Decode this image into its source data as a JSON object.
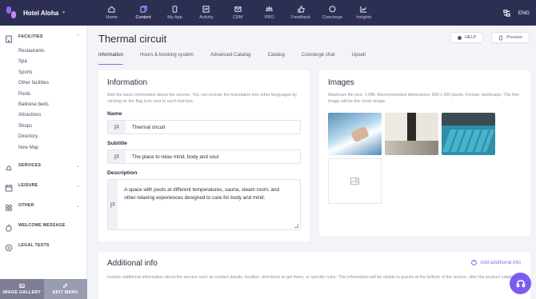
{
  "app": {
    "brand_name": "Hotel Aloha",
    "language": "ENG"
  },
  "nav": [
    {
      "label": "Home",
      "icon": "home-icon"
    },
    {
      "label": "Content",
      "icon": "content-icon",
      "active": true
    },
    {
      "label": "My App",
      "icon": "phone-icon"
    },
    {
      "label": "Activity",
      "icon": "activity-icon"
    },
    {
      "label": "CRM",
      "icon": "crm-icon"
    },
    {
      "label": "PRO",
      "icon": "pro-icon"
    },
    {
      "label": "Feedback",
      "icon": "feedback-icon"
    },
    {
      "label": "Concierge",
      "icon": "chat-icon"
    },
    {
      "label": "Insights",
      "icon": "insights-icon"
    }
  ],
  "sidebar": {
    "facilities": {
      "label": "FACILITIES",
      "items": [
        "Restaurants",
        "Spa",
        "Sports",
        "Other facilities",
        "Pools",
        "Balinese beds",
        "Attractions",
        "Shops",
        "Directory",
        "New Map"
      ]
    },
    "sections": [
      {
        "label": "SERVICES",
        "has_chevron": true
      },
      {
        "label": "LEISURE",
        "has_chevron": true
      },
      {
        "label": "OTHER",
        "has_chevron": true
      },
      {
        "label": "WELCOME MESSAGE",
        "has_chevron": false
      },
      {
        "label": "LEGAL TEXTS",
        "has_chevron": false
      }
    ],
    "bottom": {
      "image_gallery": "IMAGE GALLERY",
      "edit_menu": "EDIT MENU"
    }
  },
  "page": {
    "title": "Thermal circuit",
    "help_label": "HELP",
    "preview_label": "Preview",
    "tabs": [
      "Information",
      "Hours & booking system",
      "Advanced Catalog",
      "Catalog",
      "Concierge chat",
      "Upsell"
    ],
    "active_tab": 0
  },
  "information": {
    "heading": "Information",
    "hint": "Add the basic information about the service. You can include the translation into other languages by clicking on the flag icon next to each text box.",
    "name_label": "Name",
    "name_value": "Thermal circuit",
    "subtitle_label": "Subtitle",
    "subtitle_value": "The place to relax mind, body and soul",
    "description_label": "Description",
    "description_value": "A space with pools at different temperatures, sauna, steam room, and other relaxing experiences designed to care for body and mind."
  },
  "images": {
    "heading": "Images",
    "hint": "Maximum file size: 1 MB. Recommended dimensions: 800 x 420 pixels. Format: landscape. The first image will be the cover image."
  },
  "additional": {
    "heading": "Additional info",
    "add_label": "Add additional info",
    "hint": "Include additional information about the service such as contact details, location, directions to get there, or specific rules. This information will be visible to guests at the bottom of the screen, after the product catalog."
  },
  "colors": {
    "topbar": "#2d2f52",
    "accent": "#8e6cf5",
    "fab": "#7c5cf0"
  }
}
